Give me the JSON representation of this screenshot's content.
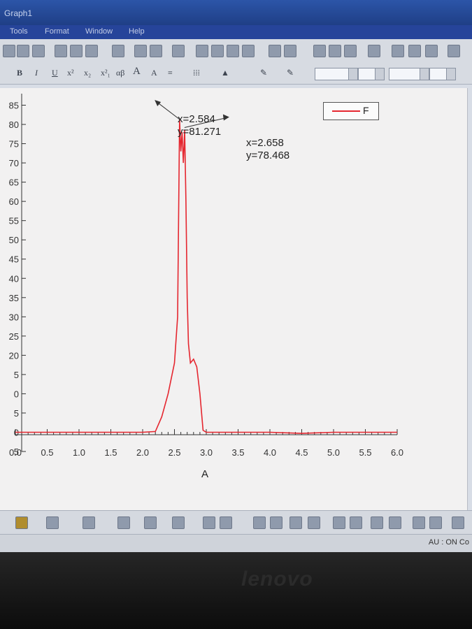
{
  "window": {
    "title": "Graph1"
  },
  "menu": [
    "Tools",
    "Format",
    "Window",
    "Help"
  ],
  "legend": {
    "label": "F"
  },
  "annotations": [
    {
      "x_label": "x=2.584",
      "y_label": "y=81.271"
    },
    {
      "x_label": "x=2.658",
      "y_label": "y=78.468"
    }
  ],
  "status": {
    "au": "AU : ON  Co"
  },
  "brand": "lenovo",
  "chart_data": {
    "type": "line",
    "xlabel": "A",
    "ylabel": "",
    "xlim": [
      0.0,
      6.0
    ],
    "ylim": [
      -5,
      88
    ],
    "x_ticks": [
      "0.0",
      "0.5",
      "1.0",
      "1.5",
      "2.0",
      "2.5",
      "3.0",
      "3.5",
      "4.0",
      "4.5",
      "5.0",
      "5.5",
      "6.0"
    ],
    "y_ticks": [
      "5",
      "0",
      "5",
      "0",
      "5",
      "20",
      "25",
      "30",
      "35",
      "40",
      "45",
      "50",
      "55",
      "60",
      "65",
      "70",
      "75",
      "80",
      "85"
    ],
    "y_tick_values": [
      -5,
      0,
      5,
      10,
      15,
      20,
      25,
      30,
      35,
      40,
      45,
      50,
      55,
      60,
      65,
      70,
      75,
      80,
      85
    ],
    "line_color": "#e5262f",
    "series": [
      {
        "name": "F",
        "x": [
          0.0,
          0.5,
          1.0,
          1.5,
          2.0,
          2.2,
          2.3,
          2.4,
          2.5,
          2.55,
          2.58,
          2.6,
          2.62,
          2.64,
          2.66,
          2.68,
          2.7,
          2.72,
          2.75,
          2.8,
          2.85,
          2.9,
          2.95,
          3.0,
          3.5,
          4.0,
          4.5,
          5.0,
          5.5,
          6.0
        ],
        "y": [
          0,
          0,
          0,
          0,
          0,
          0.2,
          4,
          10,
          18,
          30,
          81.27,
          73,
          78,
          70,
          78.47,
          60,
          35,
          23,
          18,
          19,
          17,
          10,
          0.5,
          0,
          0,
          0,
          -0.3,
          0,
          0,
          0
        ]
      }
    ]
  }
}
